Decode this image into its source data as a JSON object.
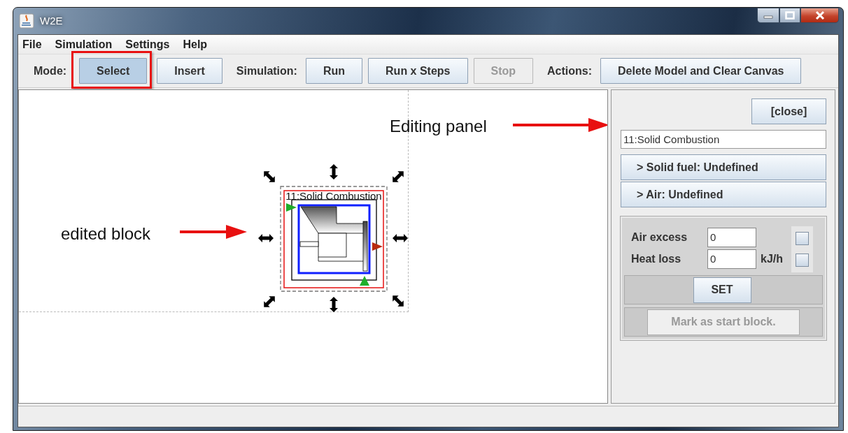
{
  "window": {
    "title": "W2E"
  },
  "menu": [
    "File",
    "Simulation",
    "Settings",
    "Help"
  ],
  "toolbar": [
    {
      "kind": "label",
      "text": "Mode:"
    },
    {
      "kind": "button",
      "text": "Select",
      "selected": true,
      "disabled": false,
      "highlighted": true
    },
    {
      "kind": "button",
      "text": "Insert",
      "selected": false,
      "disabled": false,
      "highlighted": false
    },
    {
      "kind": "label",
      "text": "Simulation:"
    },
    {
      "kind": "button",
      "text": "Run",
      "selected": false,
      "disabled": false,
      "highlighted": false
    },
    {
      "kind": "button",
      "text": "Run x Steps",
      "selected": false,
      "disabled": false,
      "highlighted": false
    },
    {
      "kind": "button",
      "text": "Stop",
      "selected": false,
      "disabled": true,
      "highlighted": false
    },
    {
      "kind": "label",
      "text": "Actions:"
    },
    {
      "kind": "button",
      "text": "Delete Model and Clear Canvas",
      "selected": false,
      "disabled": false,
      "highlighted": false
    }
  ],
  "canvas": {
    "block": {
      "label": "11:Solid Combustion",
      "selected": true
    }
  },
  "annotations": [
    {
      "text": "Editing panel"
    },
    {
      "text": "edited block"
    }
  ],
  "panel": {
    "close": "[close]",
    "name": "11:Solid Combustion",
    "sections": [
      "> Solid fuel: Undefined",
      "> Air: Undefined"
    ],
    "fields": [
      {
        "label": "Air excess",
        "value": "0",
        "checked": false
      },
      {
        "label": "Heat loss",
        "value": "0",
        "unit": "kJ/h",
        "checked": false
      }
    ],
    "set": "SET",
    "mark": {
      "text": "Mark as start block.",
      "disabled": true
    }
  }
}
